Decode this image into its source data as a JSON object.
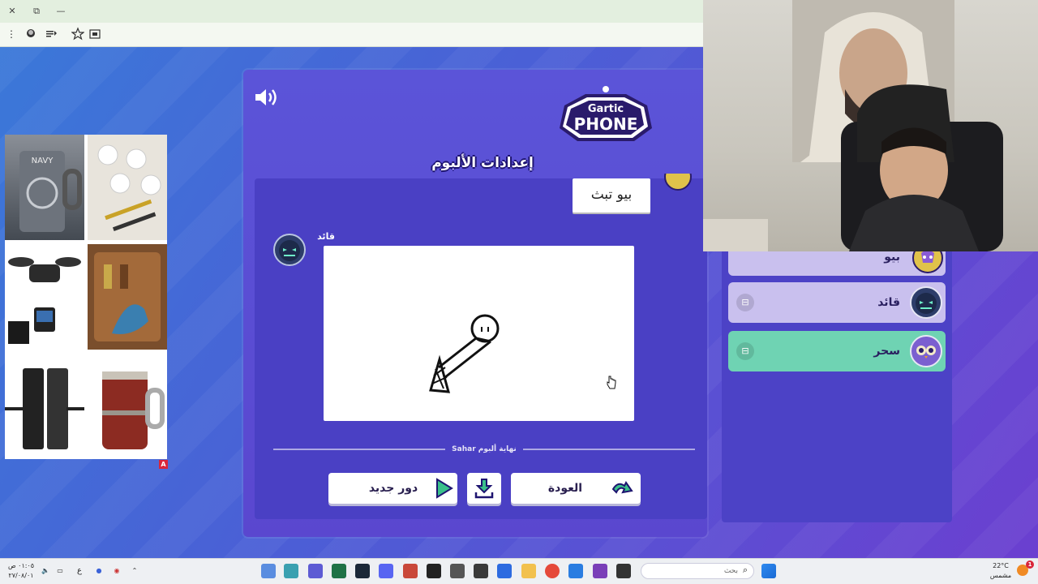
{
  "browser": {
    "close_glyph": "✕",
    "restore_glyph": "⧉",
    "minimize_glyph": "—",
    "menu_glyph": "⋮",
    "tools": [
      "profile-icon",
      "reading-list-icon",
      "star-icon",
      "tab-icon"
    ]
  },
  "game": {
    "logo_line1": "Gartic",
    "logo_line2": "PHONE",
    "album_title": "إعدادات الألبوم",
    "answer_text": "بيو تبث",
    "drawer_name": "قائد",
    "album_end": "Sahar نهاية ألبوم",
    "buttons": {
      "new_round": "دور جديد",
      "back": "العودة"
    }
  },
  "players": [
    {
      "name": "بيو",
      "color": "#c9c0ee",
      "kick": false
    },
    {
      "name": "قائد",
      "color": "#c9c0ee",
      "kick": true
    },
    {
      "name": "سحر",
      "color": "#6fd3b3",
      "kick": true
    }
  ],
  "ad": {
    "badge": "A",
    "cells": [
      "anchor-mug",
      "white-pins",
      "drone",
      "knife-set",
      "smart-lock",
      "wooden-mug"
    ]
  },
  "taskbar": {
    "time": "٠١:٠٥ ص",
    "date": "٢٧/٠٨/٠١",
    "lang": "ع",
    "search_text": "بحث",
    "weather_temp": "22°C",
    "weather_label": "مشمس",
    "notification_count": "1"
  }
}
